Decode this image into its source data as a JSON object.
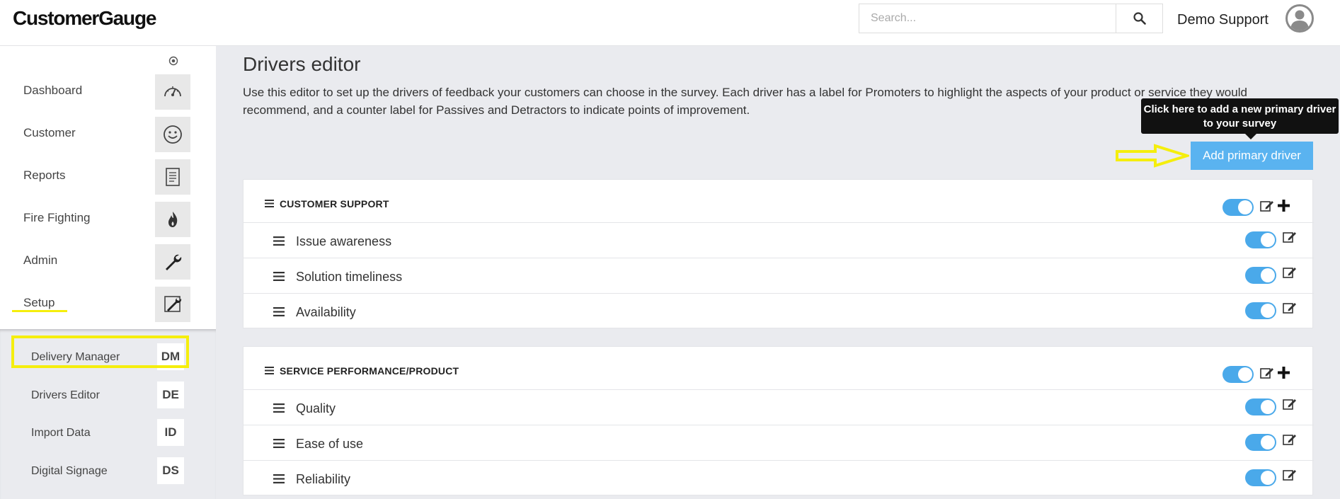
{
  "header": {
    "logo": "CustomerGauge",
    "search_placeholder": "Search...",
    "user_name": "Demo Support"
  },
  "sidebar": {
    "items": [
      {
        "label": "Dashboard",
        "icon": "speedometer-icon"
      },
      {
        "label": "Customer",
        "icon": "smiley-icon"
      },
      {
        "label": "Reports",
        "icon": "document-icon"
      },
      {
        "label": "Fire Fighting",
        "icon": "fire-icon"
      },
      {
        "label": "Admin",
        "icon": "wrench-icon"
      },
      {
        "label": "Setup",
        "icon": "setup-tools-icon"
      }
    ],
    "sub_items": [
      {
        "label": "Delivery Manager",
        "badge": "DM"
      },
      {
        "label": "Drivers Editor",
        "badge": "DE"
      },
      {
        "label": "Import Data",
        "badge": "ID"
      },
      {
        "label": "Digital Signage",
        "badge": "DS"
      }
    ]
  },
  "main": {
    "title": "Drivers editor",
    "description": "Use this editor to set up the drivers of feedback your customers can choose in the survey. Each driver has a label for Promoters to highlight the aspects of your product or service they would recommend, and a counter label for Passives and Detractors to indicate points of improvement.",
    "tooltip": "Click here to add a new primary driver to your survey",
    "add_button": "Add primary driver",
    "groups": [
      {
        "title": "CUSTOMER SUPPORT",
        "enabled": true,
        "drivers": [
          {
            "label": "Issue awareness",
            "enabled": true
          },
          {
            "label": "Solution timeliness",
            "enabled": true
          },
          {
            "label": "Availability",
            "enabled": true
          }
        ]
      },
      {
        "title": "SERVICE PERFORMANCE/PRODUCT",
        "enabled": true,
        "drivers": [
          {
            "label": "Quality",
            "enabled": true
          },
          {
            "label": "Ease of use",
            "enabled": true
          },
          {
            "label": "Reliability",
            "enabled": true
          }
        ]
      }
    ]
  },
  "colors": {
    "accent": "#5ab3f0",
    "toggle_on": "#4aa9ea",
    "highlight": "#f5ee0d",
    "tooltip_bg": "#111111"
  }
}
